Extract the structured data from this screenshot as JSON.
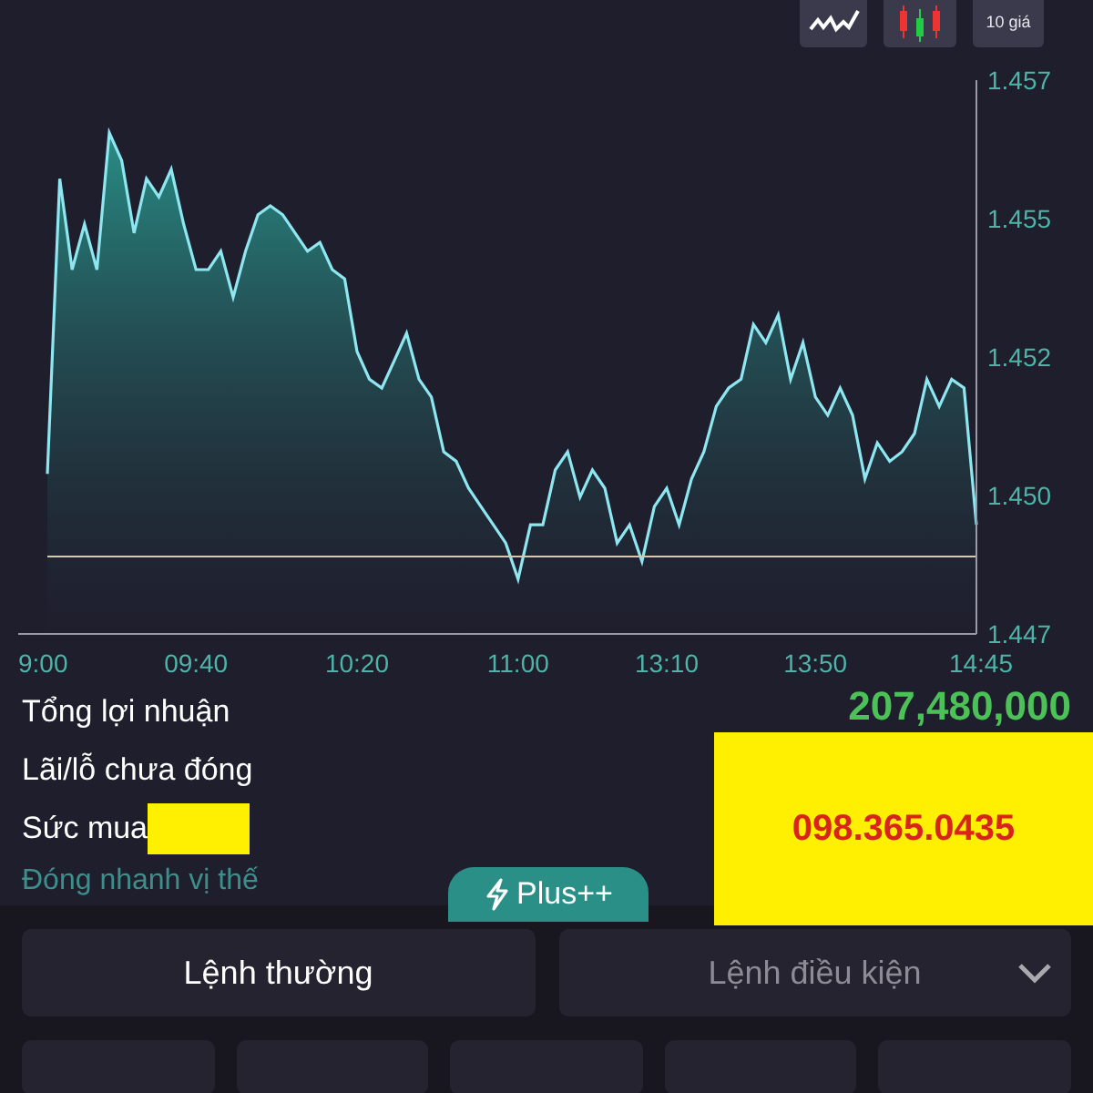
{
  "toolbar": {
    "buttons": [
      {
        "kind": "line_chart"
      },
      {
        "kind": "candles"
      },
      {
        "kind": "text",
        "label": "10 giá"
      }
    ]
  },
  "chart": {
    "chart_data": {
      "type": "area",
      "categories": [
        "9:00",
        null,
        null,
        null,
        null,
        null,
        null,
        null,
        null,
        null,
        null,
        null,
        "09:40",
        null,
        null,
        null,
        null,
        null,
        null,
        null,
        null,
        null,
        null,
        null,
        null,
        "10:20",
        null,
        null,
        null,
        null,
        null,
        null,
        null,
        null,
        null,
        null,
        null,
        null,
        "11:00",
        null,
        null,
        null,
        null,
        null,
        null,
        null,
        null,
        null,
        null,
        null,
        "13:10",
        null,
        null,
        null,
        null,
        null,
        null,
        null,
        null,
        null,
        null,
        null,
        "13:50",
        null,
        null,
        null,
        null,
        null,
        null,
        null,
        null,
        null,
        null,
        null,
        null,
        "14:45"
      ],
      "series": [
        {
          "color": "#8ee6f0",
          "values": [
            1.44989,
            1.45522,
            1.45358,
            1.4544,
            1.45358,
            1.45605,
            1.45555,
            1.45424,
            1.45522,
            1.45489,
            1.45539,
            1.4544,
            1.45358,
            1.45358,
            1.45391,
            1.45308,
            1.45391,
            1.45457,
            1.45473,
            1.45457,
            1.45424,
            1.45391,
            1.45407,
            1.45358,
            1.45341,
            1.4521,
            1.4516,
            1.45144,
            1.45193,
            1.45243,
            1.4516,
            1.45128,
            1.45029,
            1.45012,
            1.44963,
            1.4493,
            1.44897,
            1.44864,
            1.44799,
            1.44897,
            1.44897,
            1.44996,
            1.45029,
            1.44947,
            1.44996,
            1.44963,
            1.44864,
            1.44897,
            1.44831,
            1.4493,
            1.44963,
            1.44897,
            1.4498,
            1.45029,
            1.45111,
            1.45144,
            1.4516,
            1.45259,
            1.45226,
            1.45276,
            1.4516,
            1.45226,
            1.45128,
            1.45095,
            1.45144,
            1.45095,
            1.4498,
            1.45045,
            1.45012,
            1.45029,
            1.45062,
            1.4516,
            1.45111,
            1.4516,
            1.45144,
            1.44897
          ]
        }
      ],
      "ylim": [
        1.447,
        1.457
      ],
      "yticks": [
        {
          "value": 1.457,
          "label": "1.457"
        },
        {
          "value": 1.4545,
          "label": "1.455"
        },
        {
          "value": 1.452,
          "label": "1.452"
        },
        {
          "value": 1.4495,
          "label": "1.450"
        },
        {
          "value": 1.447,
          "label": "1.447"
        }
      ],
      "ref_lines": [
        {
          "axis": "y",
          "value": 1.4484
        }
      ]
    }
  },
  "summary": {
    "rows": [
      {
        "label": "Tổng lợi nhuận",
        "value": "207,480,000"
      },
      {
        "label": "Lãi/lỗ chưa đóng"
      },
      {
        "label": "Sức mua",
        "redacted": true
      }
    ],
    "quick_close_link": "Đóng nhanh vị thế"
  },
  "overlay_note": "098.365.0435",
  "plus_tab": "Plus++",
  "order_tabs": [
    {
      "label": "Lệnh thường",
      "selected": true,
      "dropdown": false
    },
    {
      "label": "Lệnh điều kiện",
      "selected": false,
      "dropdown": true
    }
  ]
}
